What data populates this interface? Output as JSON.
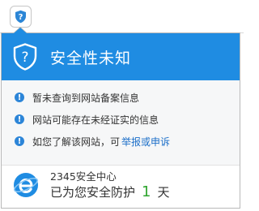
{
  "popup": {
    "title": "安全性未知",
    "messages": [
      {
        "text": "暂未查询到网站备案信息"
      },
      {
        "text": "网站可能存在未经证实的信息"
      },
      {
        "text": "如您了解该网站，可",
        "link": "举报或申诉"
      }
    ],
    "footer": {
      "product_name": "2345安全中心",
      "protect_prefix": "已为您安全防护",
      "protect_days": "1",
      "protect_suffix": "天"
    }
  },
  "icons": {
    "address_shield": "shield-question-icon",
    "header_shield": "shield-question-icon",
    "bullet": "exclamation-icon",
    "logo": "2345-browser-logo-icon"
  },
  "colors": {
    "accent_blue": "#1f8ce2",
    "link_blue": "#1c6fc9",
    "days_green": "#2fa52f",
    "info_bg": "#f6f7f8"
  }
}
